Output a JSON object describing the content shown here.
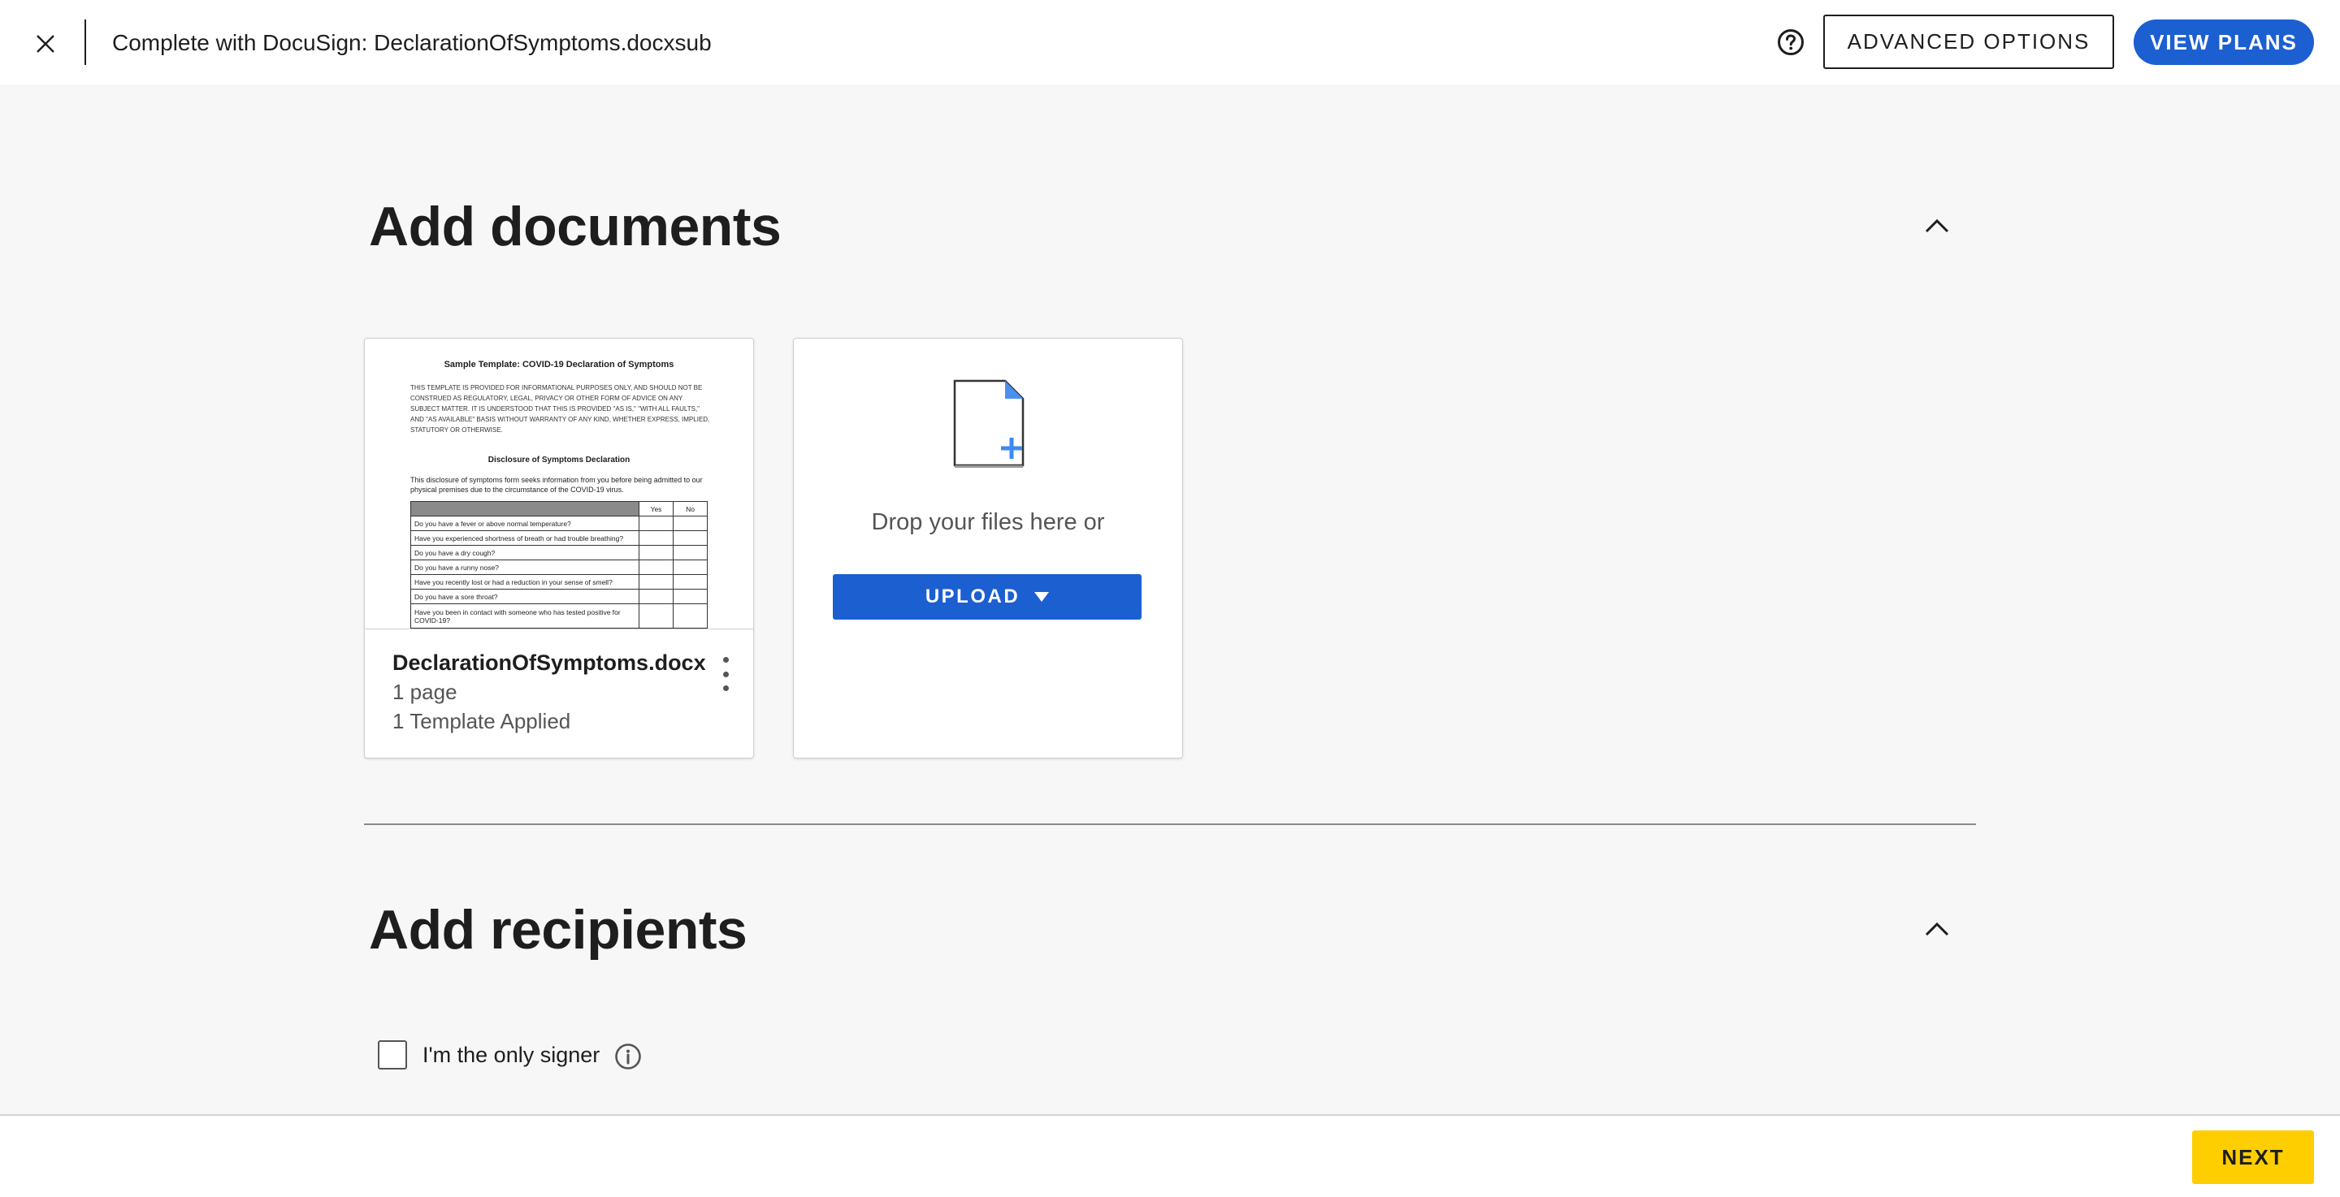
{
  "header": {
    "title": "Complete with DocuSign: DeclarationOfSymptoms.docxsub",
    "advanced_options_label": "ADVANCED OPTIONS",
    "view_plans_label": "VIEW PLANS"
  },
  "documents_section": {
    "title": "Add documents",
    "document": {
      "name": "DeclarationOfSymptoms.docx",
      "pages": "1 page",
      "templates": "1 Template Applied",
      "preview": {
        "title": "Sample Template: COVID-19 Declaration of Symptoms",
        "disclaimer": "THIS TEMPLATE IS PROVIDED FOR INFORMATIONAL PURPOSES ONLY, AND SHOULD NOT BE CONSTRUED AS REGULATORY, LEGAL, PRIVACY OR OTHER FORM OF ADVICE ON ANY SUBJECT MATTER. IT IS UNDERSTOOD THAT THIS IS PROVIDED \"AS IS,\" \"WITH ALL FAULTS,\" AND \"AS AVAILABLE\" BASIS WITHOUT WARRANTY OF ANY KIND, WHETHER EXPRESS, IMPLIED, STATUTORY OR OTHERWISE.",
        "subtitle": "Disclosure of Symptoms Declaration",
        "intro": "This disclosure of symptoms form seeks information from you before being admitted to our physical premises due to the circumstance of the COVID-19 virus.",
        "col_yes": "Yes",
        "col_no": "No",
        "questions": [
          "Do you have a fever or above normal temperature?",
          "Have you experienced shortness of breath or had trouble breathing?",
          "Do you have a dry cough?",
          "Do you have a runny nose?",
          "Have you recently lost or had a reduction in your sense of smell?",
          "Do you have a sore throat?",
          "Have you been in contact with someone who has tested positive for COVID-19?"
        ]
      }
    },
    "upload": {
      "drop_text": "Drop your files here or",
      "button_label": "UPLOAD"
    }
  },
  "recipients_section": {
    "title": "Add recipients",
    "only_signer_label": "I'm the only signer",
    "only_signer_checked": false
  },
  "footer": {
    "next_label": "NEXT"
  },
  "colors": {
    "primary_blue": "#1c5fd1",
    "next_yellow": "#ffce00",
    "background": "#f7f7f7"
  },
  "icons": [
    "close-icon",
    "help-icon",
    "chevron-up-icon",
    "more-vertical-icon",
    "file-add-icon",
    "dropdown-caret-icon",
    "info-icon"
  ]
}
